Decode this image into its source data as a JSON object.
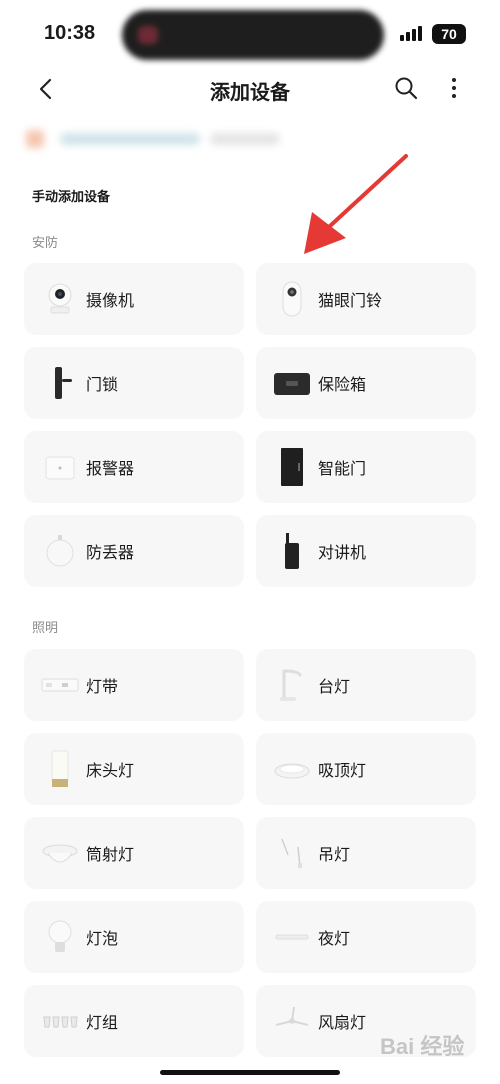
{
  "status_bar": {
    "time": "10:38",
    "battery": "70"
  },
  "nav": {
    "title": "添加设备",
    "icons": [
      "back-icon",
      "search-icon",
      "more-icon"
    ]
  },
  "section": {
    "title": "手动添加设备"
  },
  "groups": [
    {
      "label": "安防",
      "items": [
        {
          "label": "摄像机",
          "icon": "camera-icon"
        },
        {
          "label": "猫眼门铃",
          "icon": "peephole-doorbell-icon"
        },
        {
          "label": "门锁",
          "icon": "door-lock-icon"
        },
        {
          "label": "保险箱",
          "icon": "safe-box-icon"
        },
        {
          "label": "报警器",
          "icon": "alarm-icon"
        },
        {
          "label": "智能门",
          "icon": "smart-door-icon"
        },
        {
          "label": "防丢器",
          "icon": "anti-loss-tag-icon"
        },
        {
          "label": "对讲机",
          "icon": "walkie-talkie-icon"
        }
      ]
    },
    {
      "label": "照明",
      "items": [
        {
          "label": "灯带",
          "icon": "light-strip-icon"
        },
        {
          "label": "台灯",
          "icon": "desk-lamp-icon"
        },
        {
          "label": "床头灯",
          "icon": "bedside-lamp-icon"
        },
        {
          "label": "吸顶灯",
          "icon": "ceiling-light-icon"
        },
        {
          "label": "筒射灯",
          "icon": "downlight-icon"
        },
        {
          "label": "吊灯",
          "icon": "pendant-light-icon"
        },
        {
          "label": "灯泡",
          "icon": "light-bulb-icon"
        },
        {
          "label": "夜灯",
          "icon": "night-light-icon"
        },
        {
          "label": "灯组",
          "icon": "light-group-icon"
        },
        {
          "label": "风扇灯",
          "icon": "fan-light-icon"
        }
      ]
    }
  ],
  "colors": {
    "card_bg": "#f7f7f7",
    "arrow": "#e53935",
    "group_label": "#8a8a8a"
  },
  "watermark": {
    "text": "Bai 经验"
  }
}
